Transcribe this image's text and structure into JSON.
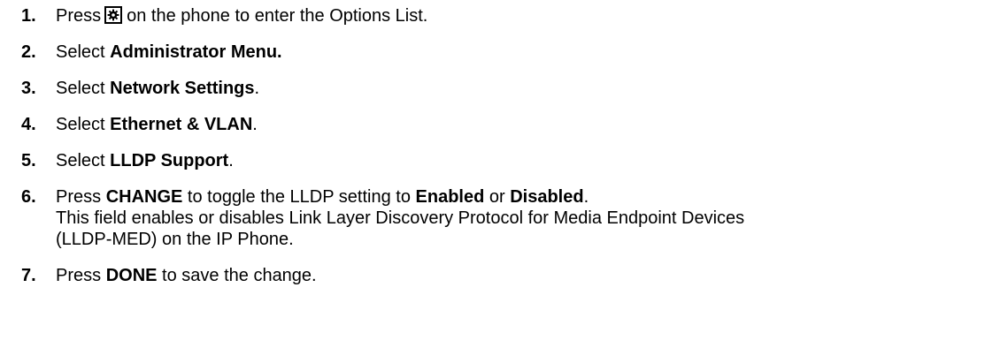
{
  "steps": [
    {
      "number": "1.",
      "parts": {
        "a": "Press",
        "icon": "gear-icon",
        "b": "on the phone to enter the Options List."
      }
    },
    {
      "number": "2.",
      "parts": {
        "a": "Select ",
        "bold": "Administrator Menu."
      }
    },
    {
      "number": "3.",
      "parts": {
        "a": "Select ",
        "bold": "Network Settings",
        "c": "."
      }
    },
    {
      "number": "4.",
      "parts": {
        "a": "Select ",
        "bold": "Ethernet & VLAN",
        "c": "."
      }
    },
    {
      "number": "5.",
      "parts": {
        "a": "Select ",
        "bold": "LLDP Support",
        "c": "."
      }
    },
    {
      "number": "6.",
      "parts": {
        "a": "Press ",
        "bold1": "CHANGE",
        "b": " to toggle the LLDP setting to ",
        "bold2": "Enabled",
        "c": " or ",
        "bold3": "Disabled",
        "d": ".",
        "line2": "This field enables or disables Link Layer Discovery Protocol for Media Endpoint Devices",
        "line3": "(LLDP-MED) on the IP Phone."
      }
    },
    {
      "number": "7.",
      "parts": {
        "a": "Press ",
        "bold": "DONE",
        "c": " to save the change."
      }
    }
  ]
}
